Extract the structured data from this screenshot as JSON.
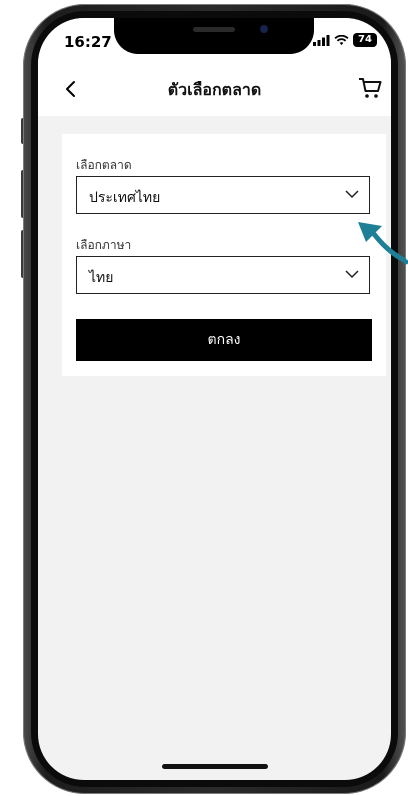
{
  "status_bar": {
    "time": "16:27",
    "battery": "74",
    "icons": [
      "location-arrow-icon",
      "signal-icon",
      "wifi-icon",
      "battery-icon"
    ]
  },
  "nav": {
    "title": "ตัวเลือกตลาด",
    "back_icon": "chevron-left-icon",
    "cart_icon": "cart-icon"
  },
  "form": {
    "market": {
      "label": "เลือกตลาด",
      "value": "ประเทศไทย"
    },
    "language": {
      "label": "เลือกภาษา",
      "value": "ไทย"
    },
    "confirm_label": "ตกลง"
  },
  "colors": {
    "button_bg": "#000000",
    "screen_bg": "#f2f2f2",
    "pointer": "#1f7f96"
  }
}
